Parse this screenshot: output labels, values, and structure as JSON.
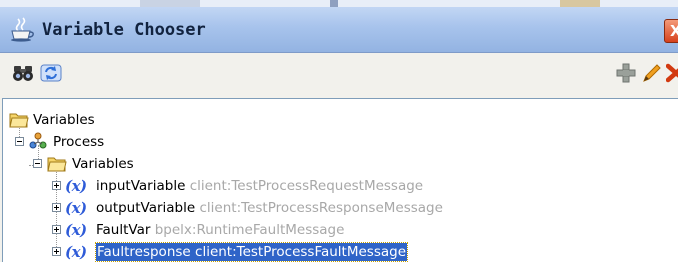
{
  "window": {
    "title": "Variable Chooser",
    "close_glyph": "X",
    "title_icon": "coffee-cup-icon"
  },
  "toolbar": {
    "left": [
      {
        "icon": "binoculars-icon"
      },
      {
        "icon": "refresh-icon"
      }
    ],
    "right": [
      {
        "icon": "add-icon"
      },
      {
        "icon": "edit-pencil-icon"
      },
      {
        "icon": "delete-icon"
      }
    ]
  },
  "tree": {
    "root_label": "Variables",
    "process_label": "Process",
    "process_vars_label": "Variables",
    "variable_icon_text": "(x)",
    "variables": [
      {
        "name": "inputVariable",
        "type": "client:TestProcessRequestMessage",
        "selected": false
      },
      {
        "name": "outputVariable",
        "type": "client:TestProcessResponseMessage",
        "selected": false
      },
      {
        "name": "FaultVar",
        "type": "bpelx:RuntimeFaultMessage",
        "selected": false
      },
      {
        "name": "Faultresponse",
        "type": "client:TestProcessFaultMessage",
        "selected": true
      }
    ]
  },
  "colors": {
    "selection": "#2f64c8",
    "type_text": "#a8a8a8",
    "variable_icon": "#2e5bd8",
    "title_bar": "#a7c3ec"
  }
}
